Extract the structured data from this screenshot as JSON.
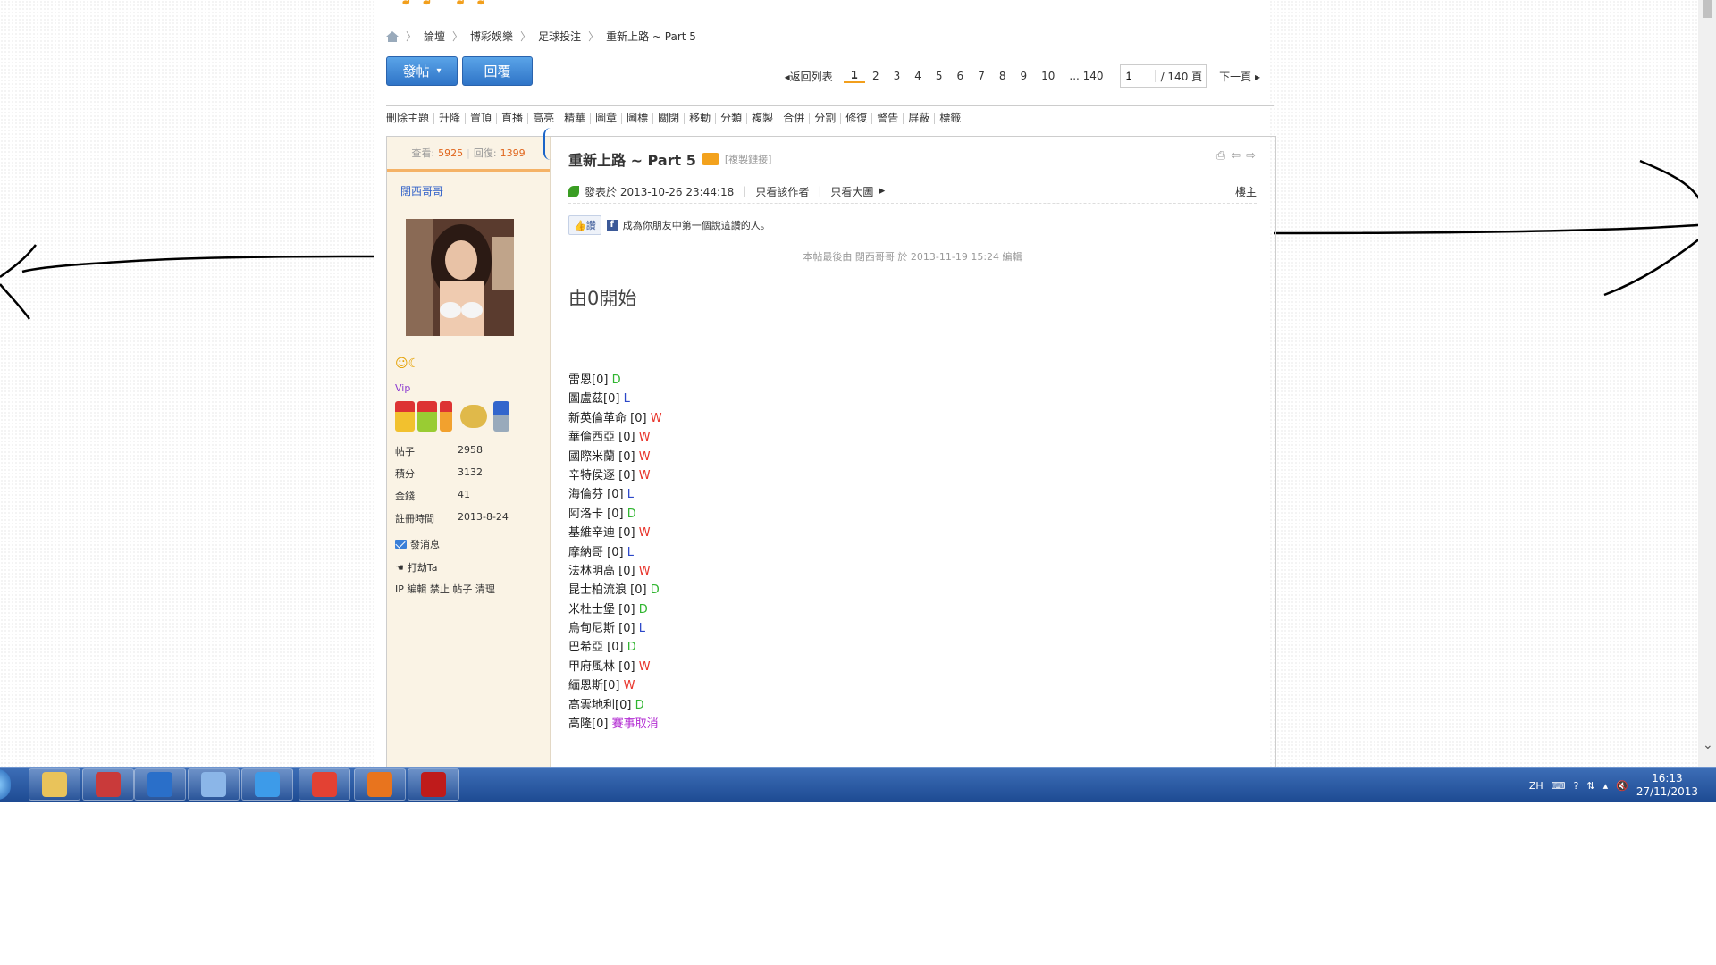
{
  "site": {
    "logo_text": "♪♪ ♪♪"
  },
  "breadcrumb": [
    "論壇",
    "博彩娛樂",
    "足球投注",
    "重新上路 ~ Part 5"
  ],
  "buttons": {
    "post": "發帖",
    "post_arrow": "▾",
    "reply": "回覆"
  },
  "pager": {
    "back": "返回列表",
    "pages": [
      "1",
      "2",
      "3",
      "4",
      "5",
      "6",
      "7",
      "8",
      "9",
      "10",
      "... 140"
    ],
    "current": "1",
    "input_value": "1",
    "total": "/ 140 頁",
    "next": "下一頁"
  },
  "modbar": [
    "刪除主題",
    "升降",
    "置頂",
    "直播",
    "高亮",
    "精華",
    "圖章",
    "圖標",
    "關閉",
    "移動",
    "分類",
    "複製",
    "合併",
    "分割",
    "修復",
    "警告",
    "屏蔽",
    "標籤"
  ],
  "stats": {
    "views_label": "查看:",
    "views": "5925",
    "replies_label": "回復:",
    "replies": "1399"
  },
  "user": {
    "name": "闊西哥哥",
    "group": "Vip",
    "faces": "☺☾",
    "info": [
      {
        "k": "帖子",
        "v": "2958"
      },
      {
        "k": "積分",
        "v": "3132"
      },
      {
        "k": "金錢",
        "v": "41"
      },
      {
        "k": "註冊時間",
        "v": "2013-8-24"
      }
    ],
    "send_msg": "發消息",
    "poke": "打劫Ta",
    "admin_links": "IP 編輯 禁止 帖子 清理"
  },
  "post": {
    "title": "重新上路 ~ Part 5",
    "copy_link": "[複製鏈接]",
    "posted_label": "發表於 2013-10-26 23:44:18",
    "only_author": "只看該作者",
    "only_images": "只看大圖",
    "floor": "樓主",
    "like_btn": "讚",
    "like_text": "成為你朋友中第一個說這讚的人。",
    "edited_note": "本帖最後由 闊西哥哥 於 2013-11-19 15:24 編輯",
    "headline": "由0開始",
    "lines": [
      {
        "team": "雷恩[0]  ",
        "result": "D",
        "cls": "r-D"
      },
      {
        "team": "圖盧茲[0]  ",
        "result": "L",
        "cls": "r-L"
      },
      {
        "team": "新英倫革命 [0] ",
        "result": "W",
        "cls": "r-W"
      },
      {
        "team": "華倫西亞 [0] ",
        "result": "W",
        "cls": "r-W"
      },
      {
        "team": "國際米蘭 [0] ",
        "result": "W",
        "cls": "r-W"
      },
      {
        "team": "辛特侯逐 [0] ",
        "result": "W",
        "cls": "r-W"
      },
      {
        "team": "海倫芬 [0] ",
        "result": "L",
        "cls": "r-L"
      },
      {
        "team": "阿洛卡 [0] ",
        "result": "D",
        "cls": "r-D"
      },
      {
        "team": "基維辛迪 [0] ",
        "result": "W",
        "cls": "r-W"
      },
      {
        "team": "摩納哥 [0] ",
        "result": "L",
        "cls": "r-L"
      },
      {
        "team": "法林明高 [0] ",
        "result": "W",
        "cls": "r-W"
      },
      {
        "team": "昆士柏流浪 [0] ",
        "result": "D",
        "cls": "r-D"
      },
      {
        "team": "米杜士堡 [0] ",
        "result": "D",
        "cls": "r-D"
      },
      {
        "team": "烏甸尼斯 [0] ",
        "result": "L",
        "cls": "r-L"
      },
      {
        "team": "巴希亞 [0] ",
        "result": "D",
        "cls": "r-D"
      },
      {
        "team": "甲府風林 [0] ",
        "result": "W",
        "cls": "r-W"
      },
      {
        "team": "緬恩斯[0] ",
        "result": "W",
        "cls": "r-W"
      },
      {
        "team": "高雲地利[0] ",
        "result": "D",
        "cls": "r-D"
      },
      {
        "team": "高隆[0] ",
        "result": "賽事取消",
        "cls": "r-X"
      }
    ]
  },
  "taskbar": {
    "apps": [
      {
        "icon": "folder-icon",
        "color": "#e9c35a"
      },
      {
        "icon": "tvb-icon",
        "color": "#c93a3a"
      },
      {
        "icon": "outlook-icon",
        "color": "#2a6fc9"
      },
      {
        "icon": "paint-icon",
        "color": "#8bb6e8"
      },
      {
        "icon": "ie-icon",
        "color": "#3d9be9"
      },
      {
        "icon": "chrome-icon",
        "color": "#e34133"
      },
      {
        "icon": "firefox-icon",
        "color": "#e8741e"
      },
      {
        "icon": "filezilla-icon",
        "color": "#bf1b1b"
      }
    ],
    "lang": "ZH",
    "time": "16:13",
    "date": "27/11/2013"
  }
}
